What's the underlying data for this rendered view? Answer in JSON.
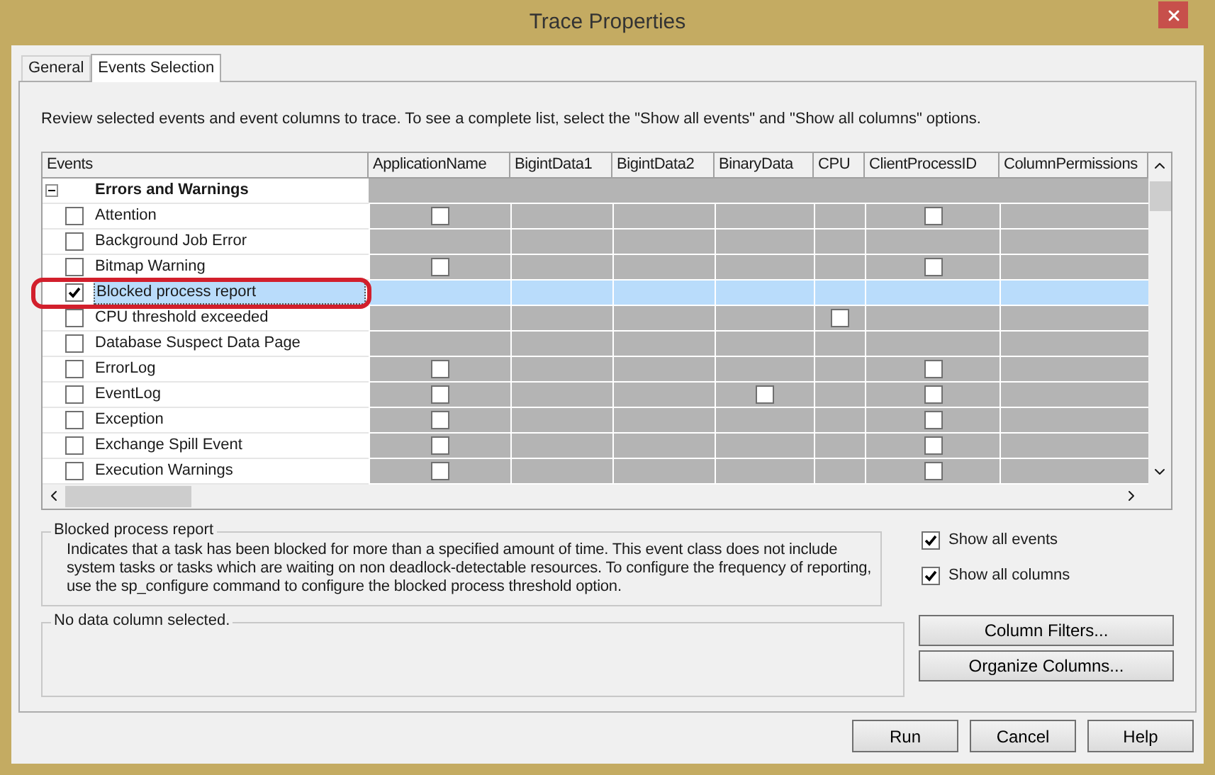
{
  "window": {
    "title": "Trace Properties"
  },
  "tabs": [
    {
      "label": "General",
      "selected": false
    },
    {
      "label": "Events Selection",
      "selected": true
    }
  ],
  "instructions": "Review selected events and event columns to trace. To see a complete list, select the \"Show all events\" and \"Show all columns\" options.",
  "grid": {
    "columns": [
      "Events",
      "ApplicationName",
      "BigintData1",
      "BigintData2",
      "BinaryData",
      "CPU",
      "ClientProcessID",
      "ColumnPermissions"
    ],
    "groups": [
      {
        "name": "Errors and Warnings",
        "expanded": true,
        "events": [
          {
            "name": "Attention",
            "checked": false,
            "selected": false,
            "cells": [
              {
                "checked": false
              },
              null,
              null,
              null,
              null,
              {
                "checked": false
              },
              null
            ]
          },
          {
            "name": "Background Job Error",
            "checked": false,
            "selected": false,
            "cells": [
              null,
              null,
              null,
              null,
              null,
              null,
              null
            ]
          },
          {
            "name": "Bitmap Warning",
            "checked": false,
            "selected": false,
            "cells": [
              {
                "checked": false
              },
              null,
              null,
              null,
              null,
              {
                "checked": false
              },
              null
            ]
          },
          {
            "name": "Blocked process report",
            "checked": true,
            "selected": true,
            "cells": [
              null,
              null,
              null,
              null,
              null,
              null,
              null
            ]
          },
          {
            "name": "CPU threshold exceeded",
            "checked": false,
            "selected": false,
            "cells": [
              null,
              null,
              null,
              null,
              {
                "checked": false
              },
              null,
              null
            ]
          },
          {
            "name": "Database Suspect Data Page",
            "checked": false,
            "selected": false,
            "cells": [
              null,
              null,
              null,
              null,
              null,
              null,
              null
            ]
          },
          {
            "name": "ErrorLog",
            "checked": false,
            "selected": false,
            "cells": [
              {
                "checked": false
              },
              null,
              null,
              null,
              null,
              {
                "checked": false
              },
              null
            ]
          },
          {
            "name": "EventLog",
            "checked": false,
            "selected": false,
            "cells": [
              {
                "checked": false
              },
              null,
              null,
              {
                "checked": false
              },
              null,
              {
                "checked": false
              },
              null
            ]
          },
          {
            "name": "Exception",
            "checked": false,
            "selected": false,
            "cells": [
              {
                "checked": false
              },
              null,
              null,
              null,
              null,
              {
                "checked": false
              },
              null
            ]
          },
          {
            "name": "Exchange Spill Event",
            "checked": false,
            "selected": false,
            "cells": [
              {
                "checked": false
              },
              null,
              null,
              null,
              null,
              {
                "checked": false
              },
              null
            ]
          },
          {
            "name": "Execution Warnings",
            "checked": false,
            "selected": false,
            "cells": [
              {
                "checked": false
              },
              null,
              null,
              null,
              null,
              {
                "checked": false
              },
              null
            ]
          }
        ]
      }
    ]
  },
  "description": {
    "title": "Blocked process report",
    "text": "Indicates that a task has been blocked for more than a specified amount of time. This event class does not include system tasks or tasks which are waiting on non deadlock-detectable resources. To configure the frequency of reporting, use the sp_configure command to configure the blocked process threshold option."
  },
  "options": [
    {
      "label": "Show all events",
      "checked": true
    },
    {
      "label": "Show all columns",
      "checked": true
    }
  ],
  "column_info": {
    "title": "No data column selected."
  },
  "side_buttons": [
    "Column Filters...",
    "Organize Columns..."
  ],
  "buttons": [
    "Run",
    "Cancel",
    "Help"
  ]
}
